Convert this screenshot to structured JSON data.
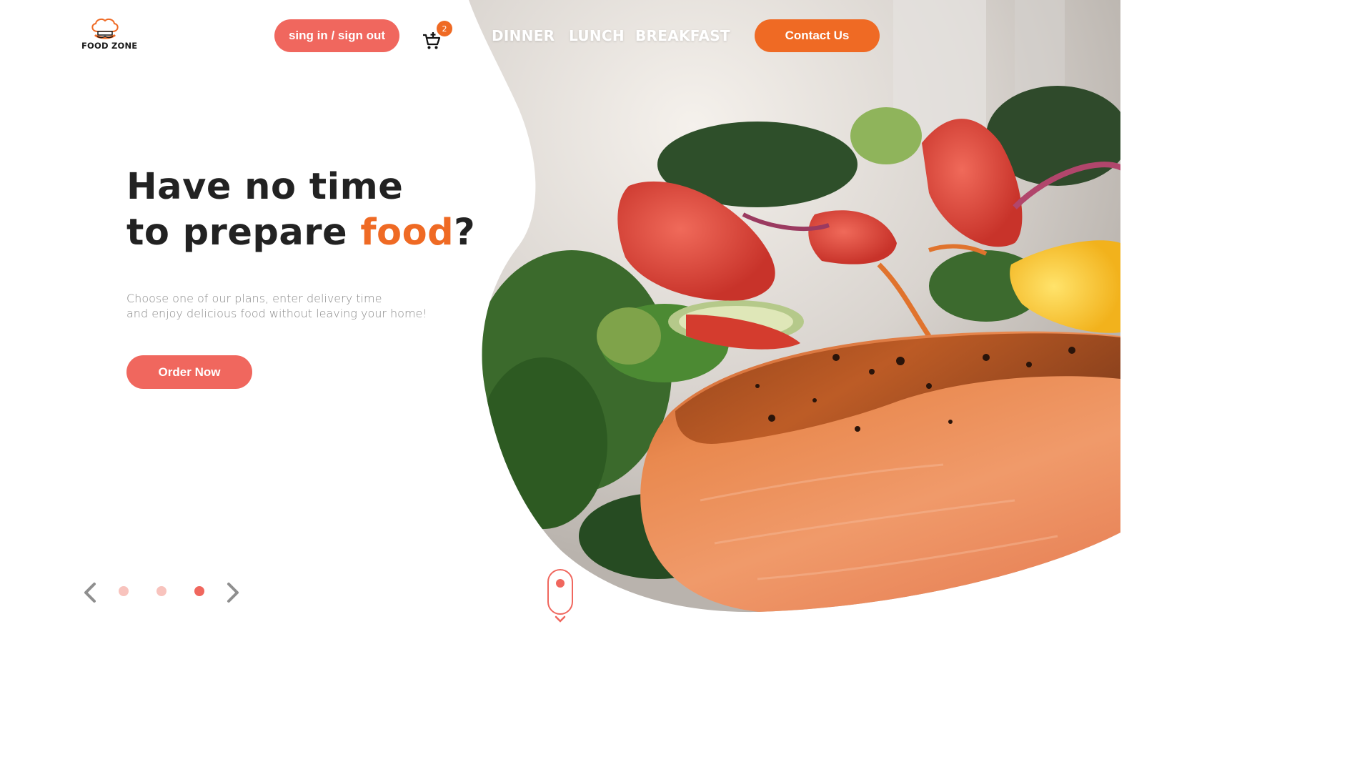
{
  "brand": {
    "name": "FOOD ZONE",
    "accent_color": "#ef6a24",
    "primary_color": "#f0675e"
  },
  "header": {
    "signin_label": "sing in / sign out",
    "cart_count": "2",
    "nav": [
      "DINNER",
      "LUNCH",
      "BREAKFAST"
    ],
    "contact_label": "Contact Us"
  },
  "hero": {
    "headline_line1": "Have no time",
    "headline_line2_prefix": "to prepare ",
    "headline_accent": "food",
    "headline_suffix": "?",
    "subtext_line1": "Choose one of our plans, enter delivery time",
    "subtext_line2": "and enjoy delicious food without leaving your home!",
    "cta_label": "Order Now",
    "image": "grilled-salmon-salad-photo"
  },
  "slider": {
    "total_slides": 3,
    "active_slide": 3
  },
  "icons": [
    "chef-hat-icon",
    "cart-icon",
    "chevron-left-icon",
    "chevron-right-icon",
    "scroll-mouse-icon",
    "chevron-down-icon"
  ]
}
